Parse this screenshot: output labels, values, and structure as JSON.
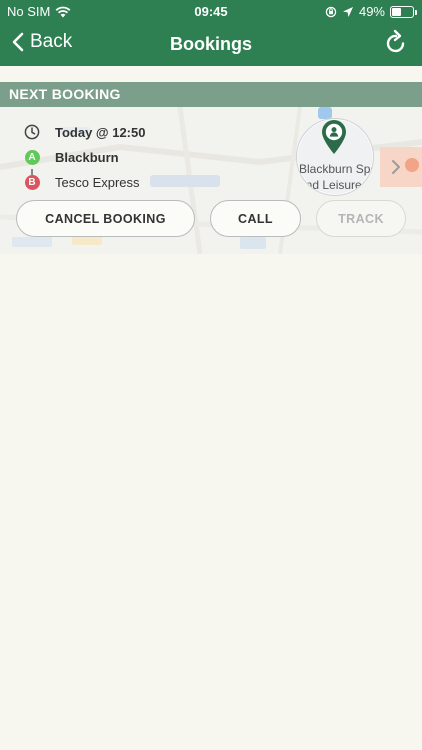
{
  "status_bar": {
    "carrier": "No SIM",
    "time": "09:45",
    "battery": "49%",
    "battery_level": 0.49
  },
  "nav": {
    "back_label": "Back",
    "title": "Bookings"
  },
  "section": {
    "title": "NEXT BOOKING"
  },
  "booking": {
    "time_text": "Today @ 12:50",
    "pickup_marker": "A",
    "pickup": "Blackburn",
    "dropoff_marker": "B",
    "dropoff": "Tesco Express",
    "map_label_line1": "Blackburn Sports",
    "map_label_line2": "and Leisure"
  },
  "buttons": {
    "cancel": "CANCEL BOOKING",
    "call": "CALL",
    "track": "TRACK"
  },
  "colors": {
    "brand_green": "#2e7f52",
    "section_band": "#7b9f8a",
    "pickup": "#5fca57",
    "dropoff": "#d9565e"
  }
}
